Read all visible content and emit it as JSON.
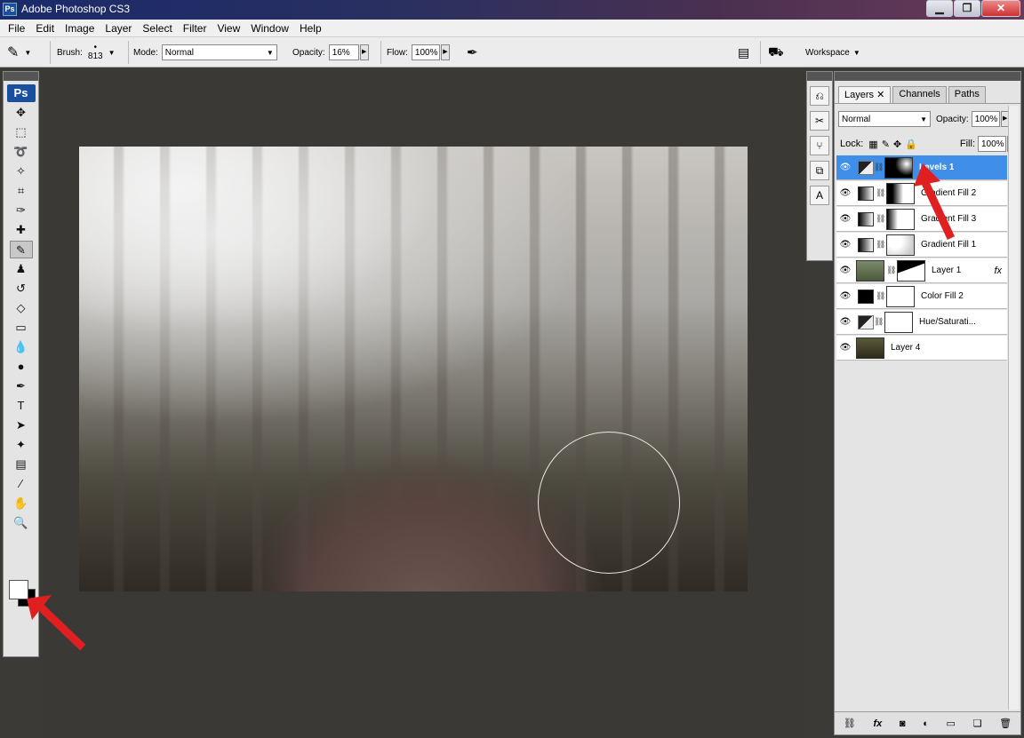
{
  "app": {
    "title": "Adobe Photoshop CS3",
    "logo": "Ps"
  },
  "window_buttons": {
    "minimize": "▁",
    "maximize": "❐",
    "close": "✕"
  },
  "menu": [
    "File",
    "Edit",
    "Image",
    "Layer",
    "Select",
    "Filter",
    "View",
    "Window",
    "Help"
  ],
  "options": {
    "brush_label": "Brush:",
    "brush_size": "813",
    "mode_label": "Mode:",
    "mode_value": "Normal",
    "opacity_label": "Opacity:",
    "opacity_value": "16%",
    "flow_label": "Flow:",
    "flow_value": "100%",
    "workspace_label": "Workspace"
  },
  "layers_panel": {
    "tabs": [
      "Layers",
      "Channels",
      "Paths"
    ],
    "blend_mode": "Normal",
    "opacity_label": "Opacity:",
    "opacity_value": "100%",
    "lock_label": "Lock:",
    "fill_label": "Fill:",
    "fill_value": "100%",
    "layers": [
      {
        "name": "Levels 1",
        "selected": true
      },
      {
        "name": "Gradient Fill 2",
        "selected": false
      },
      {
        "name": "Gradient Fill 3",
        "selected": false
      },
      {
        "name": "Gradient Fill 1",
        "selected": false
      },
      {
        "name": "Layer 1",
        "selected": false,
        "fx": "fx"
      },
      {
        "name": "Color Fill 2",
        "selected": false
      },
      {
        "name": "Hue/Saturati...",
        "selected": false
      },
      {
        "name": "Layer 4",
        "selected": false
      }
    ],
    "footer_icons": [
      "link-icon",
      "fx-icon",
      "mask-icon",
      "adjustment-icon",
      "group-icon",
      "new-layer-icon",
      "trash-icon"
    ]
  },
  "colors": {
    "accent": "#3f8ee8",
    "arrow": "#e02020"
  }
}
